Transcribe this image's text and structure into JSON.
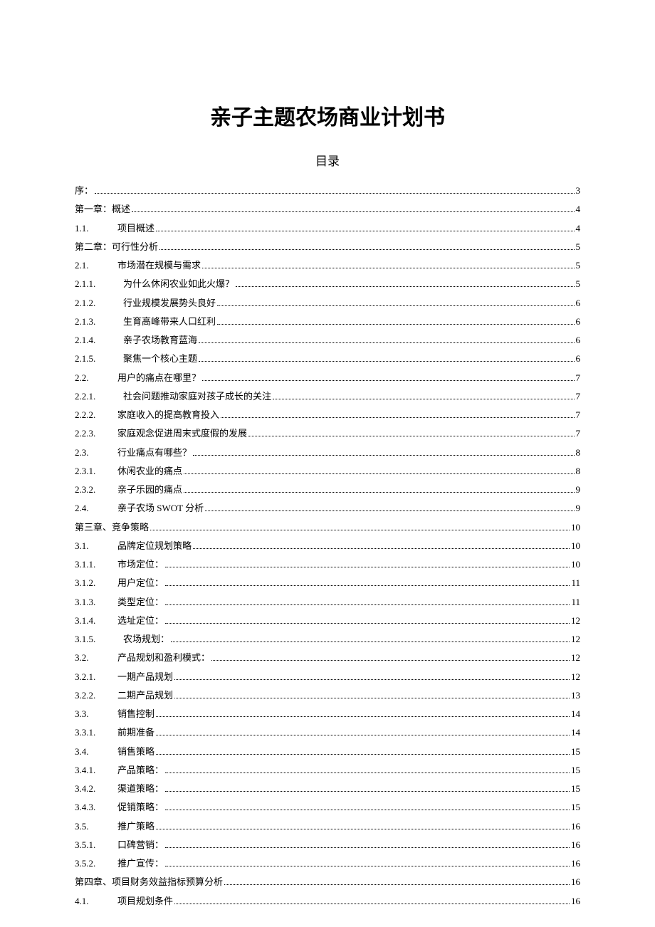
{
  "title": "亲子主题农场商业计划书",
  "subtitle": "目录",
  "toc": [
    {
      "num": "序：",
      "text": "",
      "page": "3",
      "indent": 0
    },
    {
      "num": "第一章：",
      "text": "概述",
      "page": "4",
      "indent": 0
    },
    {
      "num": "1.1.",
      "text": "项目概述",
      "page": "4",
      "indent": 1
    },
    {
      "num": "第二章：",
      "text": "可行性分析",
      "page": "5",
      "indent": 0
    },
    {
      "num": "2.1.",
      "text": "市场潜在规模与需求",
      "page": "5",
      "indent": 1
    },
    {
      "num": "2.1.1.",
      "text": "为什么休闲农业如此火爆？",
      "page": "5",
      "indent": 2
    },
    {
      "num": "2.1.2.",
      "text": "行业规模发展势头良好",
      "page": "6",
      "indent": 2
    },
    {
      "num": "2.1.3.",
      "text": "生育高峰带来人口红利",
      "page": "6",
      "indent": 2
    },
    {
      "num": "2.1.4.",
      "text": "亲子农场教育蓝海",
      "page": "6",
      "indent": 2
    },
    {
      "num": "2.1.5.",
      "text": "聚焦一个核心主题",
      "page": "6",
      "indent": 2
    },
    {
      "num": "2.2.",
      "text": "用户的痛点在哪里？",
      "page": "7",
      "indent": 1
    },
    {
      "num": "2.2.1.",
      "text": "社会问题推动家庭对孩子成长的关注",
      "page": "7",
      "indent": 2
    },
    {
      "num": "2.2.2.",
      "text": "家庭收入的提高教育投入",
      "page": "7",
      "indent": 1
    },
    {
      "num": "2.2.3.",
      "text": "家庭观念促进周末式度假的发展",
      "page": "7",
      "indent": 1
    },
    {
      "num": "2.3.",
      "text": "行业痛点有哪些？",
      "page": "8",
      "indent": 1
    },
    {
      "num": "2.3.1.",
      "text": "休闲农业的痛点",
      "page": "8",
      "indent": 1
    },
    {
      "num": "2.3.2.",
      "text": "亲子乐园的痛点",
      "page": "9",
      "indent": 1
    },
    {
      "num": "2.4.",
      "text": "亲子农场 SWOT 分析",
      "page": "9",
      "indent": 1
    },
    {
      "num": "第三章、",
      "text": "竞争策略",
      "page": "10",
      "indent": 0
    },
    {
      "num": "3.1.",
      "text": "品牌定位规划策略",
      "page": "10",
      "indent": 1
    },
    {
      "num": "3.1.1.",
      "text": "市场定位：",
      "page": "10",
      "indent": 1
    },
    {
      "num": "3.1.2.",
      "text": "用户定位：",
      "page": "11",
      "indent": 1
    },
    {
      "num": "3.1.3.",
      "text": "类型定位：",
      "page": "11",
      "indent": 1
    },
    {
      "num": "3.1.4.",
      "text": "选址定位：",
      "page": "12",
      "indent": 1
    },
    {
      "num": "3.1.5.",
      "text": "农场规划：",
      "page": "12",
      "indent": 2
    },
    {
      "num": "3.2.",
      "text": "产品规划和盈利模式：",
      "page": "12",
      "indent": 1
    },
    {
      "num": "3.2.1.",
      "text": "一期产品规划",
      "page": "12",
      "indent": 1
    },
    {
      "num": "3.2.2.",
      "text": "二期产品规划",
      "page": "13",
      "indent": 1
    },
    {
      "num": "3.3.",
      "text": "销售控制",
      "page": "14",
      "indent": 1
    },
    {
      "num": "3.3.1.",
      "text": "前期准备",
      "page": "14",
      "indent": 1
    },
    {
      "num": "3.4.",
      "text": "销售策略",
      "page": "15",
      "indent": 1
    },
    {
      "num": "3.4.1.",
      "text": "产品策略：",
      "page": "15",
      "indent": 1
    },
    {
      "num": "3.4.2.",
      "text": "渠道策略：",
      "page": "15",
      "indent": 1
    },
    {
      "num": "3.4.3.",
      "text": "促销策略：",
      "page": "15",
      "indent": 1
    },
    {
      "num": "3.5.",
      "text": "推广策略",
      "page": "16",
      "indent": 1
    },
    {
      "num": "3.5.1.",
      "text": "口碑营销：",
      "page": "16",
      "indent": 1
    },
    {
      "num": "3.5.2.",
      "text": "推广宣传：",
      "page": "16",
      "indent": 1
    },
    {
      "num": "第四章、",
      "text": "项目财务效益指标预算分析",
      "page": "16",
      "indent": 0
    },
    {
      "num": "4.1.",
      "text": "项目规划条件",
      "page": "16",
      "indent": 1
    }
  ]
}
